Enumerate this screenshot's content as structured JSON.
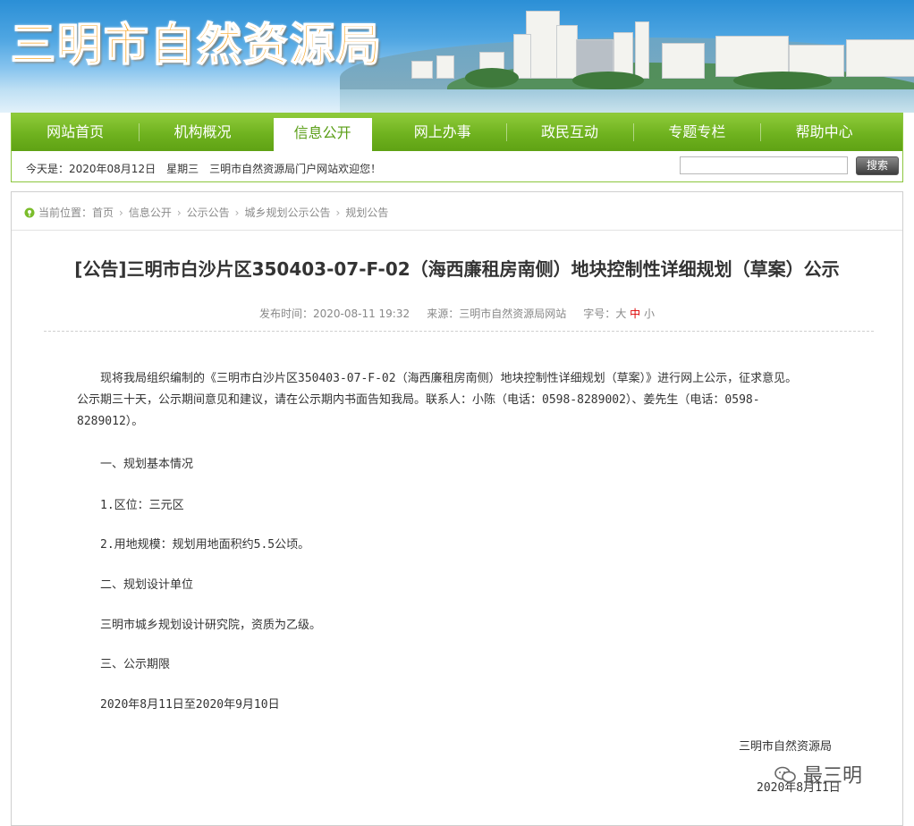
{
  "header": {
    "title": "三明市自然资源局"
  },
  "nav": {
    "items": [
      {
        "label": "网站首页"
      },
      {
        "label": "机构概况"
      },
      {
        "label": "信息公开"
      },
      {
        "label": "网上办事"
      },
      {
        "label": "政民互动"
      },
      {
        "label": "专题专栏"
      },
      {
        "label": "帮助中心"
      }
    ],
    "active_index": 2
  },
  "infobar": {
    "today": "今天是：2020年08月12日　星期三　三明市自然资源局门户网站欢迎您！",
    "search_value": "",
    "search_button": "搜索"
  },
  "breadcrumb": {
    "items": [
      "当前位置：首页",
      "信息公开",
      "公示公告",
      "城乡规划公示公告",
      "规划公告"
    ],
    "separator": "›"
  },
  "article": {
    "title": "[公告]三明市白沙片区350403-07-F-02（海西廉租房南侧）地块控制性详细规划（草案）公示",
    "meta": {
      "published": "发布时间：2020-08-11 19:32",
      "source": "来源：三明市自然资源局网站",
      "font_size_label": "字号：",
      "size_large": "大",
      "size_medium": "中",
      "size_small": "小"
    },
    "paragraphs": [
      "现将我局组织编制的《三明市白沙片区350403-07-F-02（海西廉租房南侧）地块控制性详细规划（草案）》进行网上公示，征求意见。",
      "公示期三十天，公示期间意见和建议，请在公示期内书面告知我局。联系人：小陈（电话：0598-8289002）、姜先生（电话：0598-",
      "8289012）。",
      "一、规划基本情况",
      "1.区位：三元区",
      "2.用地规模：规划用地面积约5.5公顷。",
      "二、规划设计单位",
      "三明市城乡规划设计研究院，资质为乙级。",
      "三、公示期限",
      "2020年8月11日至2020年9月10日"
    ],
    "signature": "三明市自然资源局",
    "signature_date": "2020年8月11日"
  },
  "watermark": {
    "text": "最三明",
    "icon": "wechat-icon"
  }
}
